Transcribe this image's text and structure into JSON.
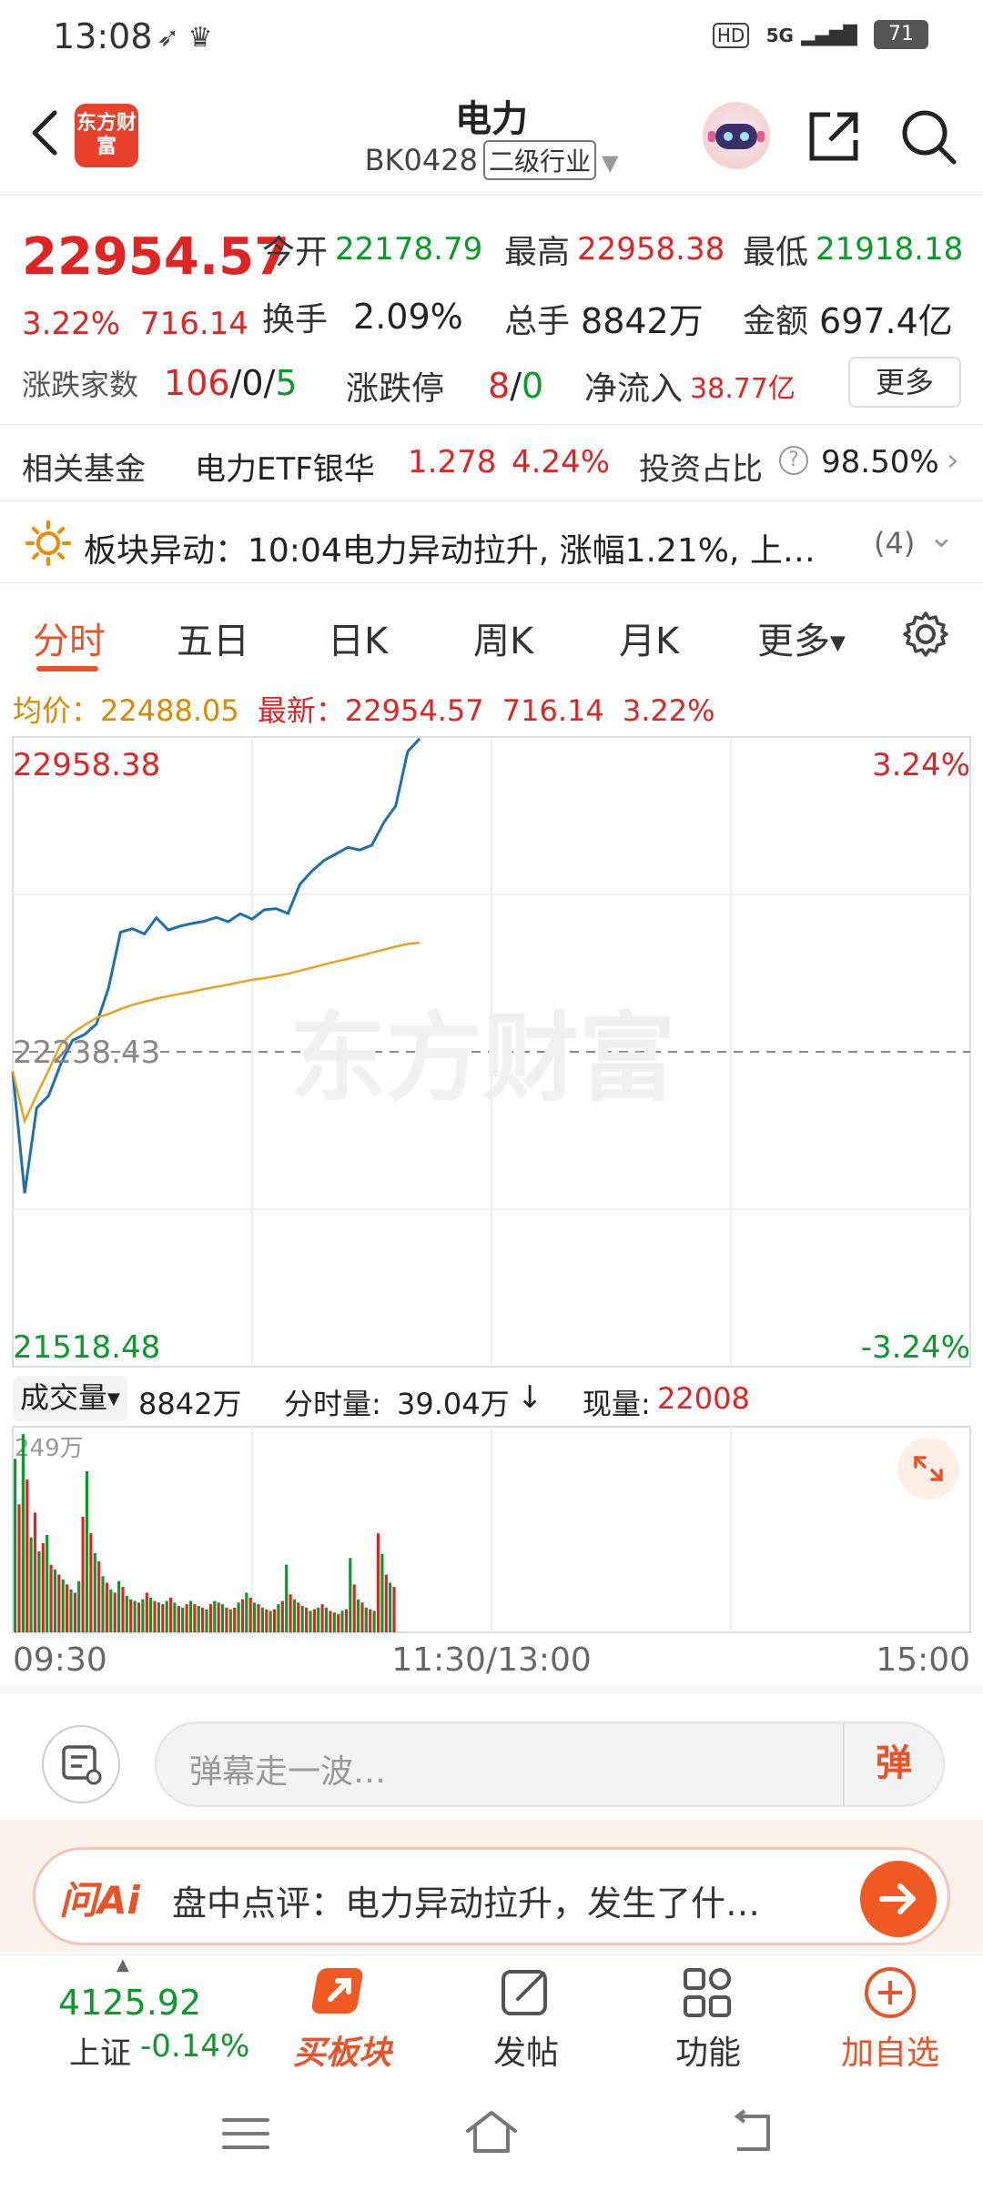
{
  "status_bar": {
    "time": "13:08",
    "network": "5G",
    "battery": "71",
    "hd": "HD"
  },
  "header": {
    "logo_text": "东方财富",
    "title": "电力",
    "code": "BK0428",
    "industry_tag": "二级行业"
  },
  "quote": {
    "price": "22954.57",
    "change_pct": "3.22%",
    "change_abs": "716.14",
    "open_label": "今开",
    "open": "22178.79",
    "high_label": "最高",
    "high": "22958.38",
    "low_label": "最低",
    "low": "21918.18",
    "turnover_label": "换手",
    "turnover": "2.09%",
    "volume_label": "总手",
    "volume": "8842万",
    "amount_label": "金额",
    "amount": "697.4亿",
    "breadth_label": "涨跌家数",
    "breadth_up": "106",
    "breadth_flat": "0",
    "breadth_down": "5",
    "limit_label": "涨跌停",
    "limit_up": "8",
    "limit_down": "0",
    "netflow_label": "净流入",
    "netflow": "38.77亿",
    "more": "更多"
  },
  "fund": {
    "label": "相关基金",
    "name": "电力ETF银华",
    "price": "1.278",
    "pct": "4.24%",
    "ratio_label": "投资占比",
    "ratio": "98.50%"
  },
  "alert": {
    "text": "板块异动：10:04电力异动拉升, 涨幅1.21%, 上…",
    "count": "(4)"
  },
  "tabs": [
    "分时",
    "五日",
    "日K",
    "周K",
    "月K",
    "更多"
  ],
  "chart_head": {
    "avg_label": "均价：",
    "avg": "22488.05",
    "latest_label": "最新：",
    "latest": "22954.57",
    "latest_abs": "716.14",
    "latest_pct": "3.22%"
  },
  "chart_labels": {
    "top_left": "22958.38",
    "top_right": "3.24%",
    "mid_left": "22238.43",
    "bottom_left": "21518.48",
    "bottom_right": "-3.24%",
    "watermark": "东方财富",
    "vol_max": "249万",
    "t_start": "09:30",
    "t_mid": "11:30/13:00",
    "t_end": "15:00"
  },
  "chart_data": {
    "type": "line",
    "ylim": [
      21518.48,
      22958.38
    ],
    "prev_close": 22238.43,
    "series": [
      {
        "values": [
          22193,
          21915,
          22110,
          22138,
          22210,
          22265,
          22278,
          22302,
          22384,
          22512,
          22520,
          22508,
          22545,
          22517,
          22526,
          22532,
          22537,
          22546,
          22536,
          22554,
          22542,
          22563,
          22566,
          22555,
          22622,
          22652,
          22676,
          22691,
          22706,
          22700,
          22711,
          22763,
          22801,
          22925,
          22954.57
        ]
      },
      {
        "values": [
          22193,
          22080,
          22140,
          22196,
          22255,
          22282,
          22300,
          22316,
          22325,
          22336,
          22346,
          22353,
          22360,
          22366,
          22371,
          22376,
          22382,
          22387,
          22392,
          22398,
          22403,
          22407,
          22412,
          22417,
          22424,
          22431,
          22438,
          22445,
          22451,
          22458,
          22465,
          22472,
          22479,
          22485,
          22488.05
        ]
      }
    ],
    "volume_unit": "万",
    "volume_ylim": [
      0,
      249
    ],
    "volumes": [
      210,
      155,
      240,
      185,
      115,
      145,
      98,
      108,
      118,
      82,
      76,
      70,
      64,
      58,
      52,
      48,
      62,
      140,
      195,
      120,
      96,
      86,
      68,
      60,
      52,
      48,
      62,
      55,
      44,
      40,
      38,
      36,
      40,
      48,
      42,
      38,
      36,
      34,
      38,
      42,
      36,
      32,
      30,
      34,
      38,
      34,
      32,
      30,
      28,
      34,
      38,
      36,
      34,
      30,
      28,
      30,
      36,
      40,
      48,
      42,
      36,
      34,
      30,
      28,
      26,
      28,
      34,
      38,
      82,
      46,
      40,
      36,
      32,
      30,
      26,
      28,
      30,
      34,
      30,
      26,
      24,
      22,
      26,
      28,
      90,
      58,
      40,
      36,
      30,
      28,
      26,
      120,
      95,
      70,
      60,
      55
    ],
    "volume_colors": "rg"
  },
  "vol_head": {
    "type_label": "成交量",
    "type_value": "8842万",
    "minute_label": "分时量:",
    "minute_value": "39.04万",
    "current_label": "现量:",
    "current_value": "22008"
  },
  "danmaku": {
    "placeholder": "弹幕走一波…",
    "button": "弹"
  },
  "ai": {
    "logo": "问Ai",
    "text": "盘中点评：电力异动拉升，发生了什…"
  },
  "bottom": {
    "index_value": "4125.92",
    "index_name": "上证",
    "index_change": "-0.14%",
    "buy": "买板块",
    "post": "发帖",
    "func": "功能",
    "watch": "加自选"
  },
  "colors": {
    "up": "#e02424",
    "down": "#0a9a2a",
    "accent": "#e8542a",
    "price_line": "#1e6fb0",
    "avg_line": "#e8a21e"
  }
}
